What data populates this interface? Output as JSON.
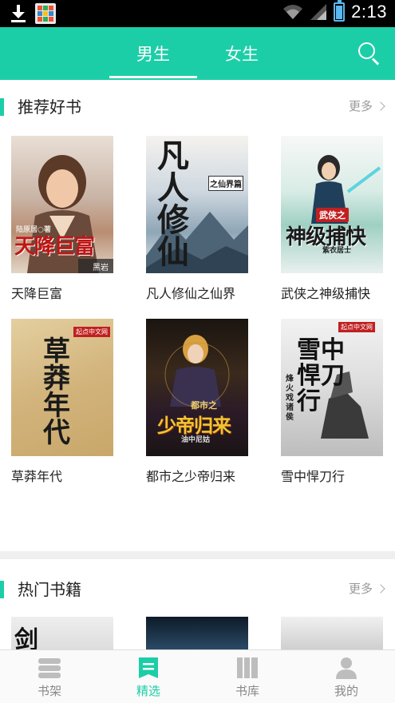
{
  "status_bar": {
    "time": "2:13",
    "battery_level": 0.85,
    "icons": [
      "download-icon",
      "app-notification-icon",
      "wifi-icon",
      "signal-icon",
      "battery-icon"
    ]
  },
  "header": {
    "tabs": [
      {
        "label": "男生",
        "active": true
      },
      {
        "label": "女生",
        "active": false
      }
    ],
    "search_icon": "search-icon"
  },
  "recommended": {
    "title": "推荐好书",
    "more_label": "更多",
    "books": [
      {
        "title": "天降巨富",
        "cover_text": "天降巨富",
        "cover_author": "陆原居○著",
        "cover_publisher": "黑岩"
      },
      {
        "title": "凡人修仙之仙界",
        "cover_text": "凡人修仙",
        "cover_subtitle": "之仙界篇"
      },
      {
        "title": "武侠之神级捕快",
        "cover_text": "神级捕快",
        "cover_subtitle": "武侠之",
        "cover_author": "紫衣居士"
      },
      {
        "title": "草莽年代",
        "cover_text": "草莽年代",
        "cover_publisher": "起点中文网"
      },
      {
        "title": "都市之少帝归来",
        "cover_text": "少帝归来",
        "cover_subtitle": "都市之",
        "cover_author": "油中尼姑"
      },
      {
        "title": "雪中悍刀行",
        "cover_text": "雪中悍刀行",
        "cover_author": "烽火戏诸侯",
        "cover_publisher": "起点中文网"
      }
    ]
  },
  "popular": {
    "title": "热门书籍",
    "more_label": "更多",
    "books": [
      {
        "cover_text": "剑"
      },
      {
        "cover_text": ""
      },
      {
        "cover_text": ""
      }
    ]
  },
  "bottom_nav": [
    {
      "label": "书架",
      "icon": "bookshelf-icon",
      "active": false
    },
    {
      "label": "精选",
      "icon": "featured-icon",
      "active": true
    },
    {
      "label": "书库",
      "icon": "library-icon",
      "active": false
    },
    {
      "label": "我的",
      "icon": "profile-icon",
      "active": false
    }
  ],
  "colors": {
    "accent": "#1ccea7",
    "status_bar": "#000000",
    "battery": "#5bb8f0"
  }
}
